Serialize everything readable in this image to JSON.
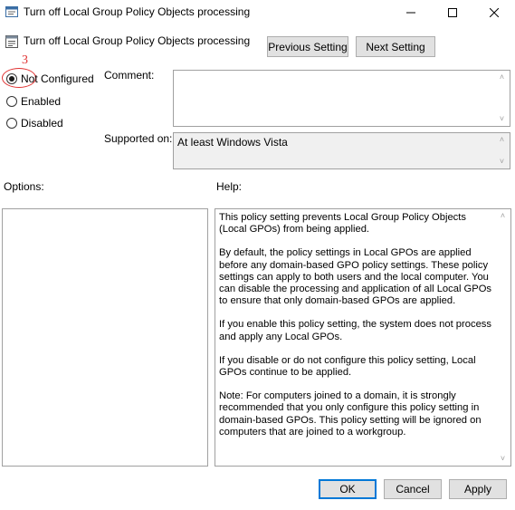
{
  "window": {
    "title": "Turn off Local Group Policy Objects processing",
    "controls": {
      "minimize": "minimize",
      "maximize": "maximize",
      "close": "close"
    }
  },
  "header": {
    "policy_name": "Turn off Local Group Policy Objects processing",
    "previous_setting": "Previous Setting",
    "next_setting": "Next Setting"
  },
  "state": {
    "options": [
      {
        "label": "Not Configured",
        "checked": true
      },
      {
        "label": "Enabled",
        "checked": false
      },
      {
        "label": "Disabled",
        "checked": false
      }
    ],
    "annotation_number": "3",
    "annotation_color": "#e03030"
  },
  "comment": {
    "label": "Comment:",
    "value": ""
  },
  "supported": {
    "label": "Supported on:",
    "value": "At least Windows Vista"
  },
  "options_section": {
    "label": "Options:"
  },
  "help_section": {
    "label": "Help:",
    "paragraphs": [
      "This policy setting prevents Local Group Policy Objects (Local GPOs) from being applied.",
      "By default, the policy settings in Local GPOs are applied before any domain-based GPO policy settings. These policy settings can apply to both users and the local computer. You can disable the processing and application of all Local GPOs to ensure that only domain-based GPOs are applied.",
      "If you enable this policy setting, the system does not process and apply any Local GPOs.",
      "If you disable or do not configure this policy setting, Local GPOs continue to be applied.",
      "Note: For computers joined to a domain, it is strongly recommended that you only configure this policy setting  in domain-based GPOs. This policy setting will be ignored on computers that are joined to a workgroup."
    ]
  },
  "footer": {
    "ok": "OK",
    "cancel": "Cancel",
    "apply": "Apply"
  },
  "colors": {
    "accent": "#0078d7",
    "button_bg": "#e1e1e1",
    "border": "#a0a0a0"
  }
}
